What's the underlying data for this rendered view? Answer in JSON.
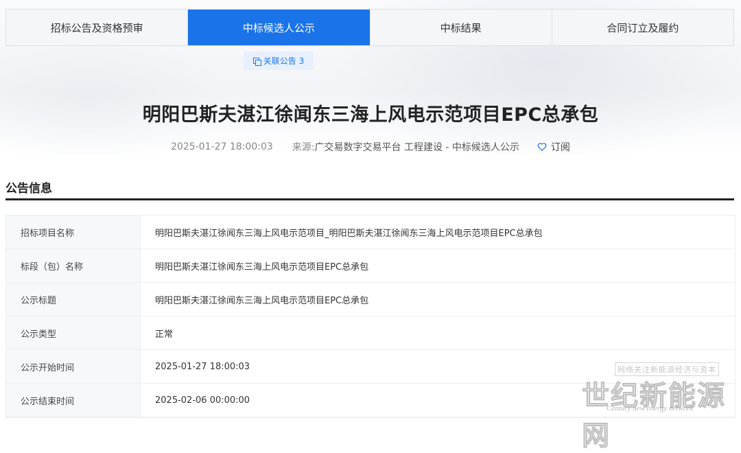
{
  "tabs": [
    {
      "label": "招标公告及资格预审",
      "active": false
    },
    {
      "label": "中标候选人公示",
      "active": true
    },
    {
      "label": "中标结果",
      "active": false
    },
    {
      "label": "合同订立及履约",
      "active": false
    }
  ],
  "related": {
    "label": "关联公告 3",
    "icon": "copy-icon"
  },
  "notice": {
    "title": "明阳巴斯夫湛江徐闻东三海上风电示范项目EPC总承包",
    "date": "2025-01-27 18:00:03",
    "source_label": "来源:",
    "source": "广交易数字交易平台 工程建设 - 中标候选人公示",
    "subscribe_label": "订阅",
    "subscribe_icon": "heart-icon"
  },
  "section": {
    "title": "公告信息"
  },
  "info_rows": [
    {
      "key": "招标项目名称",
      "value": "明阳巴斯夫湛江徐闻东三海上风电示范项目_明阳巴斯夫湛江徐闻东三海上风电示范项目EPC总承包"
    },
    {
      "key": "标段（包）名称",
      "value": "明阳巴斯夫湛江徐闻东三海上风电示范项目EPC总承包"
    },
    {
      "key": "公示标题",
      "value": "明阳巴斯夫湛江徐闻东三海上风电示范项目EPC总承包"
    },
    {
      "key": "公示类型",
      "value": "正常"
    },
    {
      "key": "公示开始时间",
      "value": "2025-01-27 18:00:03"
    },
    {
      "key": "公示结束时间",
      "value": "2025-02-06 00:00:00"
    }
  ],
  "watermark": {
    "top": "网络关注新能源经济与资本",
    "main": "世纪新能源网",
    "sub": "Century new energy network"
  },
  "colors": {
    "accent": "#1a73e8",
    "accent_light": "#e8f0fd"
  }
}
